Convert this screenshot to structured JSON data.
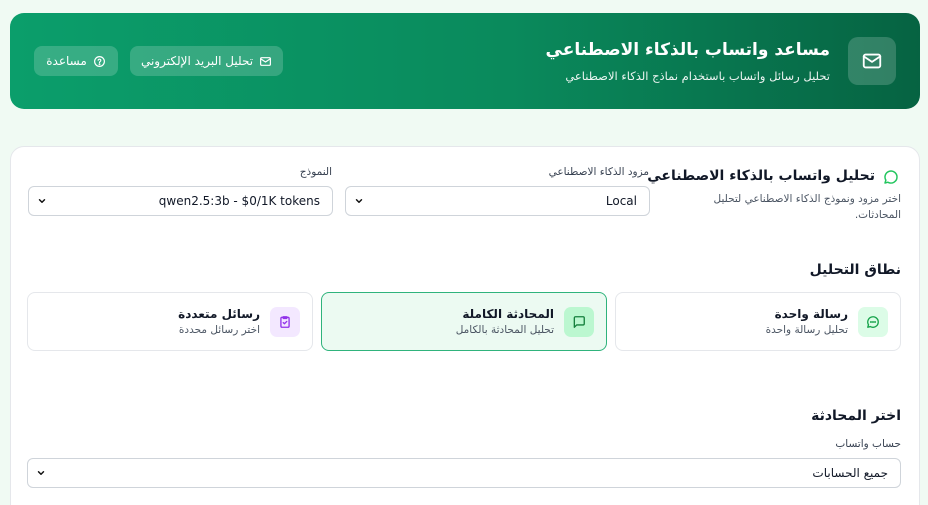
{
  "header": {
    "title": "مساعد واتساب بالذكاء الاصطناعي",
    "subtitle": "تحليل رسائل واتساب باستخدام نماذج الذكاء الاصطناعي",
    "icon": "mail-icon",
    "buttons": {
      "email_analysis": "تحليل البريد الإلكتروني",
      "help": "مساعدة"
    }
  },
  "panel": {
    "title": "تحليل واتساب بالذكاء الاصطناعي",
    "description": "اختر مزود ونموذج الذكاء الاصطناعي لتحليل المحادثات.",
    "provider": {
      "label": "مزود الذكاء الاصطناعي",
      "value": "Local"
    },
    "model": {
      "label": "النموذج",
      "value": "qwen2.5:3b - $0/1K tokens"
    }
  },
  "scope": {
    "title": "نطاق التحليل",
    "options": [
      {
        "title": "رسالة واحدة",
        "subtitle": "تحليل رسالة واحدة",
        "icon": "chat-bubble-icon",
        "selected": false
      },
      {
        "title": "المحادثة الكاملة",
        "subtitle": "تحليل المحادثة بالكامل",
        "icon": "message-square-icon",
        "selected": true
      },
      {
        "title": "رسائل متعددة",
        "subtitle": "اختر رسائل محددة",
        "icon": "clipboard-check-icon",
        "selected": false
      }
    ]
  },
  "conversation": {
    "title": "اختر المحادثة",
    "account": {
      "label": "حساب واتساب",
      "value": "جميع الحسابات"
    }
  },
  "colors": {
    "header_start": "#0b9e6b",
    "header_end": "#066342",
    "accent": "#22c55e",
    "multi_icon": "#9333ea"
  }
}
